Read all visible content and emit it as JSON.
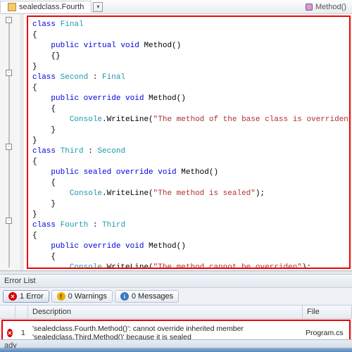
{
  "tabs": {
    "active": "sealedclass.Fourth",
    "crumb": "Method()"
  },
  "code": {
    "c1": "Final",
    "c2": "Second",
    "c3": "Third",
    "c4": "Fourth",
    "pv": "public virtual void",
    "po": "public override void",
    "pso": "public sealed override void",
    "m": "Method",
    "cw": "Console",
    "wl": ".WriteLine(",
    "s1": "\"The method of the base class is overriden\"",
    "s2": "\"The method is sealed\"",
    "s3": "\"The method cannot be overriden\"",
    "kw_class": "class"
  },
  "errorlist": {
    "title": "Error List",
    "tabs": {
      "errors": "1 Error",
      "warnings": "0 Warnings",
      "messages": "0 Messages"
    },
    "cols": {
      "desc": "Description",
      "file": "File"
    },
    "row": {
      "num": "1",
      "desc": "'sealedclass.Fourth.Method()': cannot override inherited member 'sealedclass.Third.Method()' because it is sealed",
      "file": "Program.cs"
    }
  },
  "status": "ady"
}
